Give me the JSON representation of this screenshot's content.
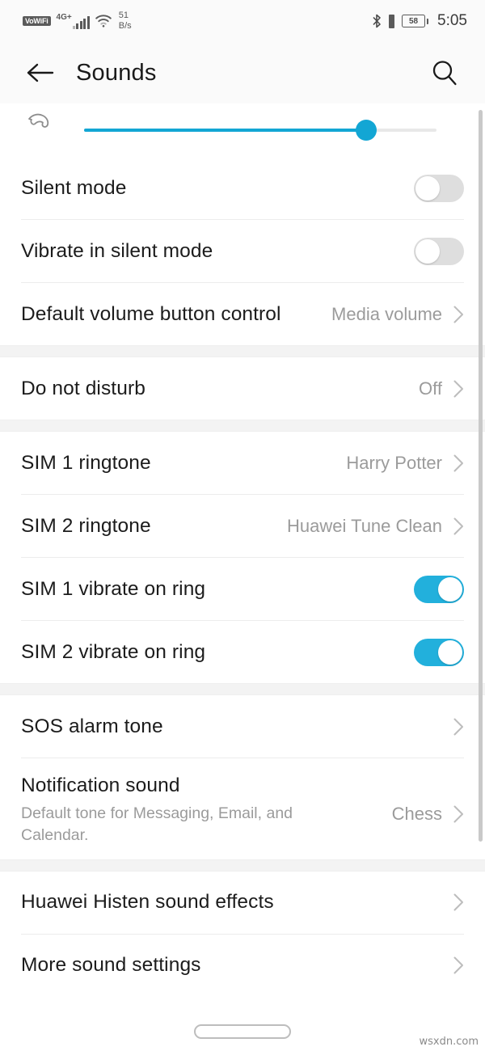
{
  "status_bar": {
    "vowifi_label": "VoWiFi",
    "network_type": "4G+",
    "data_rate_value": "51",
    "data_rate_unit": "B/s",
    "battery_percent": "58",
    "time": "5:05",
    "icons": [
      "vowifi-icon",
      "signal-bars-icon",
      "wifi-icon",
      "bluetooth-icon",
      "vibrate-icon",
      "battery-icon"
    ]
  },
  "app_bar": {
    "title": "Sounds",
    "back_icon": "arrow-left-icon",
    "search_icon": "search-icon"
  },
  "volume_slider": {
    "icon": "phone-ringtone-icon",
    "fill_percent": 80
  },
  "sections": [
    {
      "rows": [
        {
          "label": "Silent mode",
          "type": "toggle",
          "on": false
        },
        {
          "label": "Vibrate in silent mode",
          "type": "toggle",
          "on": false
        },
        {
          "label": "Default volume button control",
          "type": "link",
          "value": "Media volume"
        }
      ]
    },
    {
      "rows": [
        {
          "label": "Do not disturb",
          "type": "link",
          "value": "Off"
        }
      ]
    },
    {
      "rows": [
        {
          "label": "SIM 1 ringtone",
          "type": "link",
          "value": "Harry Potter"
        },
        {
          "label": "SIM 2 ringtone",
          "type": "link",
          "value": "Huawei Tune Clean"
        },
        {
          "label": "SIM 1 vibrate on ring",
          "type": "toggle",
          "on": true
        },
        {
          "label": "SIM 2 vibrate on ring",
          "type": "toggle",
          "on": true
        }
      ]
    },
    {
      "rows": [
        {
          "label": "SOS alarm tone",
          "type": "link",
          "value": ""
        },
        {
          "label": "Notification sound",
          "type": "link",
          "value": "Chess",
          "sublabel": "Default tone for Messaging, Email, and Calendar."
        }
      ]
    },
    {
      "rows": [
        {
          "label": "Huawei Histen sound effects",
          "type": "link",
          "value": ""
        },
        {
          "label": "More sound settings",
          "type": "link",
          "value": ""
        }
      ]
    }
  ],
  "nav_bar": {
    "home_pill": "home-indicator"
  },
  "watermark": "wsxdn.com",
  "colors": {
    "accent": "#22b0dc",
    "slider_fill": "#13a6d4",
    "toggle_off": "#dedede",
    "label_text": "#1c1c1c",
    "value_text": "#9b9b9b",
    "section_gap": "#f3f3f3",
    "bar_bg": "#fafafa"
  }
}
